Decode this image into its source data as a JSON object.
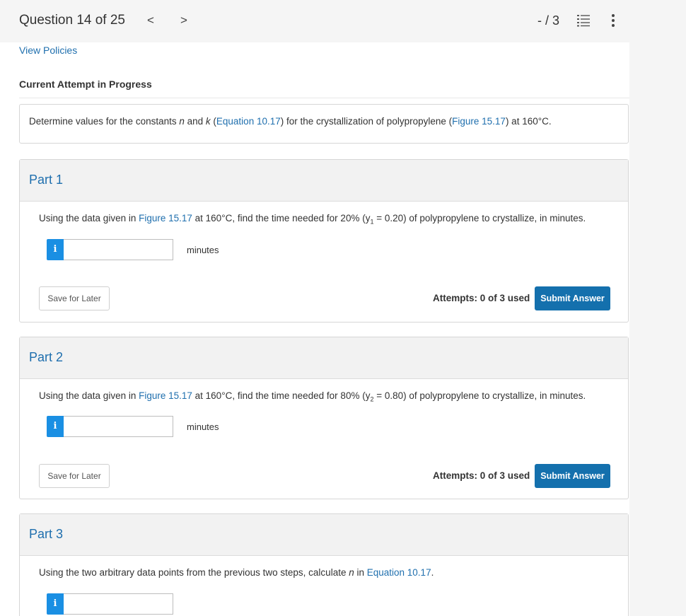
{
  "header": {
    "question_counter": "Question 14 of 25",
    "prev_glyph": "<",
    "next_glyph": ">",
    "score": "- / 3"
  },
  "policies_link": "View Policies",
  "attempt_status": "Current Attempt in Progress",
  "question": {
    "text_1": "Determine values for the constants ",
    "var_n": "n",
    "text_2": " and ",
    "var_k": "k",
    "text_3": " (",
    "link_equation": "Equation 10.17",
    "text_4": ") for the crystallization of polypropylene (",
    "link_figure": "Figure 15.17",
    "text_5": ") at 160°C."
  },
  "parts": [
    {
      "title": "Part 1",
      "prompt_a": "Using the data given in ",
      "prompt_link": "Figure 15.17",
      "prompt_b": " at 160°C, find the time needed for 20% (y",
      "prompt_sub": "1",
      "prompt_c": " = 0.20) of polypropylene to crystallize, in minutes.",
      "unit": "minutes",
      "save_label": "Save for Later",
      "attempts": "Attempts: 0 of 3 used",
      "submit_label": "Submit Answer"
    },
    {
      "title": "Part 2",
      "prompt_a": "Using the data given in ",
      "prompt_link": "Figure 15.17",
      "prompt_b": " at 160°C, find the time needed for 80% (y",
      "prompt_sub": "2",
      "prompt_c": " = 0.80) of polypropylene to crystallize, in minutes.",
      "unit": "minutes",
      "save_label": "Save for Later",
      "attempts": "Attempts: 0 of 3 used",
      "submit_label": "Submit Answer"
    },
    {
      "title": "Part 3",
      "prompt_a": "Using the two arbitrary data points from the previous two steps, calculate ",
      "prompt_var": "n",
      "prompt_b": " in ",
      "prompt_link": "Equation 10.17",
      "prompt_c": "."
    }
  ],
  "info_glyph": "i",
  "colors": {
    "link": "#1f6fae",
    "submit": "#1470ad",
    "info": "#1a8fe3"
  }
}
